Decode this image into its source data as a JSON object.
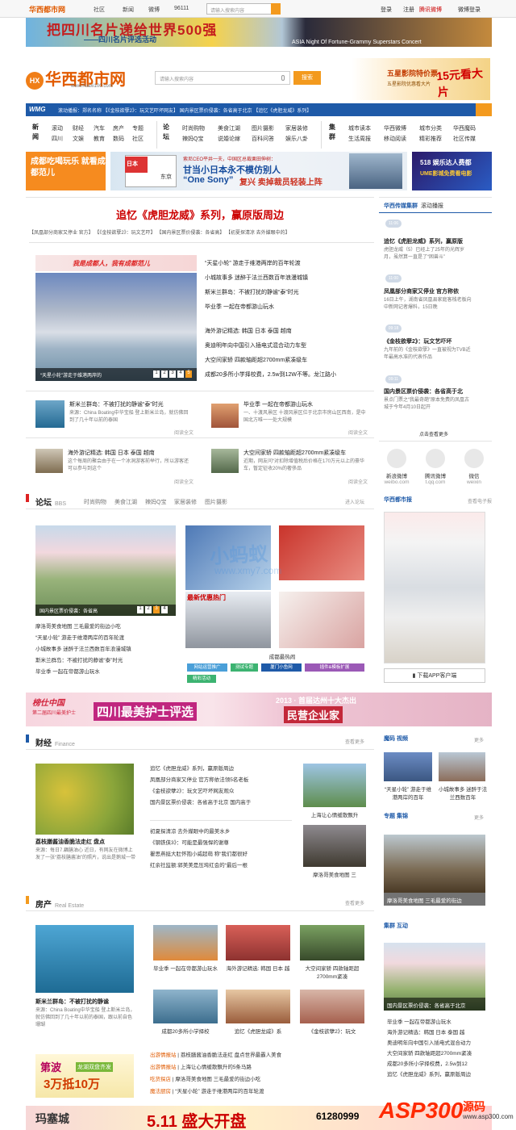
{
  "topbar": {
    "logo": "华西都市网",
    "nav": [
      "社区",
      "新闻",
      "微博",
      "96111"
    ],
    "search_placeholder": "请输入搜索内容",
    "links": [
      "登录",
      "注册",
      "腾讯微博",
      "微博登录"
    ]
  },
  "banner1": {
    "t1": "把四川名片递给世界500强",
    "t2": "——四川名片评选活动",
    "t3": "ASIA Night Of Fortune-Grammy Superstars Concert"
  },
  "header": {
    "logo": "华西都市网",
    "logo_mark": "HX",
    "url": "www.huaxi100.com",
    "search_placeholder": "请输入搜索内容",
    "search_btn": "搜索",
    "ad1": "五星影院特价票",
    "ad2": "五星影院优惠看大片",
    "ad3": "15元看大片"
  },
  "ticker": {
    "label": "WMG",
    "text": "滚动播报：郑名名称    【《金枝欲孽2》：玩文艺吓坏网友】   国内景区票价侵袭：各省高于北京    【追忆《虎胆龙威》系列】"
  },
  "nav": {
    "groups": [
      {
        "title": "新闻",
        "rows": [
          [
            "滚动",
            "财经",
            "汽车",
            "房产",
            "专题"
          ],
          [
            "四川",
            "文娱",
            "教育",
            "数码",
            "社区"
          ]
        ]
      },
      {
        "title": "论坛",
        "rows": [
          [
            "时尚购物",
            "美食江湖",
            "图片摄影",
            "家居装修"
          ],
          [
            "辣妈Q宝",
            "说婚论嫁",
            "百科问答",
            "娱乐八卦"
          ]
        ]
      },
      {
        "title": "集群",
        "rows": [
          [
            "城市读本",
            "华西微博",
            "城市分类",
            "华西魔码"
          ],
          [
            "生活周报",
            "移动阅读",
            "精彩推荐",
            "社区传媒"
          ]
        ]
      }
    ]
  },
  "ads": {
    "a": "成都吃喝玩乐 就看成都范儿",
    "b_line1": "索尼CEO平井一夫，中国区总裁栗田伸树：",
    "b_line2": "甘当小日本永不模仿别人",
    "b_line3": "“One Sony”",
    "b_line4": "复兴 卖掉裁员轻装上阵",
    "b_map1": "日本",
    "b_map2": "东京",
    "c_line1": "518 娱乐达人费都",
    "c_line2": "UME影城免费看电影"
  },
  "main": {
    "headline": "追忆《虎胆龙威》系列，赢原版周边",
    "subheads": "【凤凰部分商家又停业 官方】  【《金枝欲孽2》：玩文艺吓】  【国内景区票价侵袭：各省高】  【初夏探清凉 去外媒眼中的】",
    "pic_banner": "我是成都人，我有成都范儿",
    "pic_caption": "“天星小轮”游走于维港两岸的",
    "pages": [
      "1",
      "2",
      "3",
      "4",
      "5"
    ],
    "list1": [
      "“天星小轮” 游走于维港两岸的百年轮渡",
      "小城故事多 迷醉于法兰西数百年浪漫城镇",
      "斯米兰群岛：不被打扰的静谧“泰”时光",
      "毕业季 一起在帝都游山玩水"
    ],
    "list2": [
      "海外游记精选: 韩国 日本 泰国 越南",
      "奥迪明年向中国引入插电式混合动力车型",
      "大空间家轿 四款轴距超2700mm紧凑级车",
      "成都20多所小学择校费，2.5w到12W不等。龙江路小"
    ],
    "cards": [
      {
        "title": "斯米兰群岛：不被打扰的静谧“泰”时光",
        "desc": "来源：China Boating中华宝船 登上斯米兰岛，就仿佛回到了几十年以前的泰国",
        "more": "阅读全文"
      },
      {
        "title": "毕业季 一起在帝都游山玩水",
        "desc": "一、十渡风景区 十渡风景区位于北京市房山区西南，是中国北方唯一一处大规模",
        "more": "阅读全文"
      },
      {
        "title": "海外游记精选: 韩国 日本 泰国 越南",
        "desc": "这个每周的聚会由于在一个冰洞游客前举行，所以游客还可以参与到这个",
        "more": "阅读全文"
      },
      {
        "title": "大空间家轿 四款轴距超2700mm紧凑级车",
        "desc": "近期，网友问“对扣除增值税后价格在170万元以上的豪华车，暂定征收20%的奢侈品",
        "more": "阅读全文"
      }
    ]
  },
  "sidebar": {
    "title": "华西传媒集群",
    "subtitle": "滚动播报",
    "timeline": [
      {
        "time": "11:06",
        "title": "追忆《虎胆龙威》系列，赢原版",
        "desc": "虎胆龙威（5）已经上了25年的光辉岁月，虽然算一直是了“困兽斗”"
      },
      {
        "time": "11:00",
        "title": "凤凰部分商家又停业 官方称依",
        "desc": "16日上午，湖南省凤凰县家庭客栈老板向中新网记者爆料，15日晚"
      },
      {
        "time": "09:18",
        "title": "《金枝欲孽2》：玩文艺吓坏",
        "desc": "九年前的《金枝欲孽》一直被视为TVB近年最高水准的代表作品"
      },
      {
        "time": "09:11",
        "title": "国内景区票价侵袭：各省高于北",
        "desc": "景点门票之“我最奇葩”原本免费的凤凰古城于今年4月10日起开"
      }
    ],
    "more": "点击查看更多",
    "social": [
      "新浪微博",
      "腾讯微博",
      "微信"
    ],
    "social_sub": [
      "weibo.com",
      "t.qq.com",
      "weixin"
    ],
    "paper_title": "华西都市报",
    "paper_more": "查看电子报",
    "app_btn": "下载APP客户端",
    "video_title": "魔码 视频",
    "video_caps": [
      "“天星小轮” 游走于维港两岸的百年",
      "小城故事多 迷醉于法兰西数百年"
    ],
    "cluster_title": "专题 集锦",
    "cluster_cap": "摩洛哥美食地图 三毛最爱的街边",
    "interact_title": "集群 互动",
    "interact_cap": "国内景区票价侵袭：各省高于北京",
    "interact_list": [
      "毕业季 一起在帝都游山玩水",
      "海外游记精选：韩国 日本 泰国 越",
      "奥迪明年向中国引入插电式混合动力",
      "大空间家轿 四款轴距超2700mm紧凑",
      "成都20多所小学择校费，2.5w到12",
      "追忆《虎胆龙威》系列，赢原版周边"
    ],
    "more_label": "更多"
  },
  "forum": {
    "title": "论坛",
    "sub": "BBS",
    "tabs": [
      "时尚购物",
      "美食江湖",
      "辣妈Q宝",
      "家居装修",
      "图片摄影"
    ],
    "more": "进入论坛",
    "caption": "国内景区票价侵袭：各省高",
    "pages": [
      "1",
      "2",
      "3",
      "4"
    ],
    "list": [
      "摩洛哥美食地图 三毛最爱的街边小吃",
      "“天星小轮” 游走于维港两岸的百年轮渡",
      "小城故事多 迷醉于法兰西数百年浪漫城镇",
      "斯米兰群岛：不被打扰的静谧“泰”时光",
      "毕业季 一起在帝都游山玩水"
    ],
    "buttons": [
      "网站运营推广",
      "测试专题",
      "厦门小鱼网",
      "插件&模板扩展",
      "精彩活动"
    ],
    "hot_label": "成都最热闹",
    "hot_label2": "最新优惠热门",
    "watermark": "小蚂蚁",
    "watermark_url": "www.xmy7.com"
  },
  "banner2": {
    "t1": "榜仕中国",
    "t2": "第二届四川最美护士",
    "t3": "四川最美护士评选",
    "t4": "2013 · 首届达州十大杰出",
    "t5": "民营企业家"
  },
  "finance": {
    "title": "财经",
    "sub": "Finance",
    "more": "查看更多",
    "photo_title": "荔枝膳酱油香脆法走红 盘点",
    "photo_desc": "来源：每日7.藕膳油心 近日，有网友在微博上发了一张“荔枝膳酱油”的照片，说出是鹅城一带",
    "list1": [
      "追忆《虎胆龙威》系列，赢原版周边",
      "凤凰部分商家又停业 官方称依法领5名老板",
      "《金枝欲孽2》：玩文艺吓坏网友观众",
      "国内景区票价侵袭：各省高于北京 国内高于"
    ],
    "list2": [
      "初夏探清凉 去外媒眼中的最美水乡",
      "《钢铁侠3》：可能是最强悍的谢尊",
      "瞿思燕挺大肚怀抱小威超萌 称“我们都很好",
      "红余社监额:郭美美是压垮红会的“最后一根"
    ],
    "right_caps": [
      "上海让心情缓散飘升",
      "摩洛哥美食地图 三"
    ]
  },
  "estate": {
    "title": "房产",
    "sub": "Real Estate",
    "more": "查看更多",
    "photo_title": "斯米兰群岛：不被打扰的静谧",
    "photo_desc": "来源：China Boating中华宝船 登上斯米兰岛，就仿佛回到了几十年以前的泰国，跟以前自色珊瑚",
    "grid_caps": [
      "毕业季 一起在帝都游山玩水",
      "海外游记精选: 韩国 日本 越",
      "大空间家轿 四款轴距超2700mm紧凑",
      "成都20多所小学择校",
      "追忆《虎胆龙威》系",
      "《金枝欲孽2》：玩文"
    ],
    "ad_t1": "第波",
    "ad_t2": "龙湖双盘齐发",
    "ad_t3": "3万抵10万",
    "tags": [
      "出游情报站",
      "出游情报站",
      "吃货探店",
      "魔法厨房"
    ],
    "tag_list": [
      "荔枝膳酱油香脆法走红 盘点世界最霸人美食",
      "上海让心情缓散飘升的5条马路",
      "摩洛哥美食地图 三毛最爱的街边小吃",
      "“天星小轮” 游走于维港两岸的百年轮渡"
    ]
  },
  "bottom_ad": {
    "t1": "玛塞城",
    "t2": "5.11 盛大开盘",
    "t3": "61280999"
  },
  "asp_logo": {
    "a": "ASP300",
    "b": "源码",
    "c": "www.asp300.com"
  },
  "colors": {
    "brand_orange": "#f39a1e",
    "brand_blue": "#1e5aa8",
    "headline_red": "#cc0000"
  }
}
